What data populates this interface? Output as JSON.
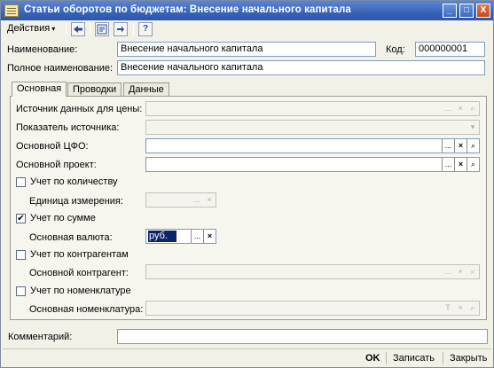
{
  "window": {
    "title": "Статьи оборотов по бюджетам: Внесение начального капитала",
    "minimize_label": "_",
    "maximize_label": "□",
    "close_label": "X"
  },
  "toolbar": {
    "actions_label": "Действия",
    "actions_arrow": "▾",
    "icons": [
      "back-icon",
      "structure-icon",
      "refresh-icon",
      "help-icon"
    ],
    "help_glyph": "?"
  },
  "form": {
    "name_label": "Наименование:",
    "name_value": "Внесение начального капитала",
    "code_label": "Код:",
    "code_value": "000000001",
    "fullname_label": "Полное наименование:",
    "fullname_value": "Внесение начального капитала"
  },
  "tabs": [
    "Основная",
    "Проводки",
    "Данные"
  ],
  "main_tab": {
    "price_source_label": "Источник данных для цены:",
    "price_source_value": "",
    "source_indicator_label": "Показатель источника:",
    "source_indicator_value": "",
    "cfo_label": "Основной ЦФО:",
    "cfo_value": "",
    "project_label": "Основной проект:",
    "project_value": "",
    "qty_check_label": "Учет по количеству",
    "qty_checked": false,
    "unit_label": "Единица измерения:",
    "unit_value": "",
    "sum_check_label": "Учет по сумме",
    "sum_checked": true,
    "currency_label": "Основная валюта:",
    "currency_value": "руб.",
    "contractor_check_label": "Учет по контрагентам",
    "contractor_checked": false,
    "contractor_label": "Основной контрагент:",
    "contractor_value": "",
    "nomenclature_check_label": "Учет по номенклатуре",
    "nomenclature_checked": false,
    "nomenclature_label": "Основная номенклатура:",
    "nomenclature_value": ""
  },
  "glyphs": {
    "select": "...",
    "clear": "×",
    "open": "⌕",
    "dropdown": "▾",
    "type": "T",
    "check": "✔"
  },
  "comment": {
    "label": "Комментарий:",
    "value": ""
  },
  "footer": {
    "ok_label": "OK",
    "save_label": "Записать",
    "close_label": "Закрыть"
  },
  "colors": {
    "title_bar": "#3764b8",
    "window_bg": "#f2f1e8",
    "field_border": "#7f9db9",
    "selection": "#0a246a"
  }
}
